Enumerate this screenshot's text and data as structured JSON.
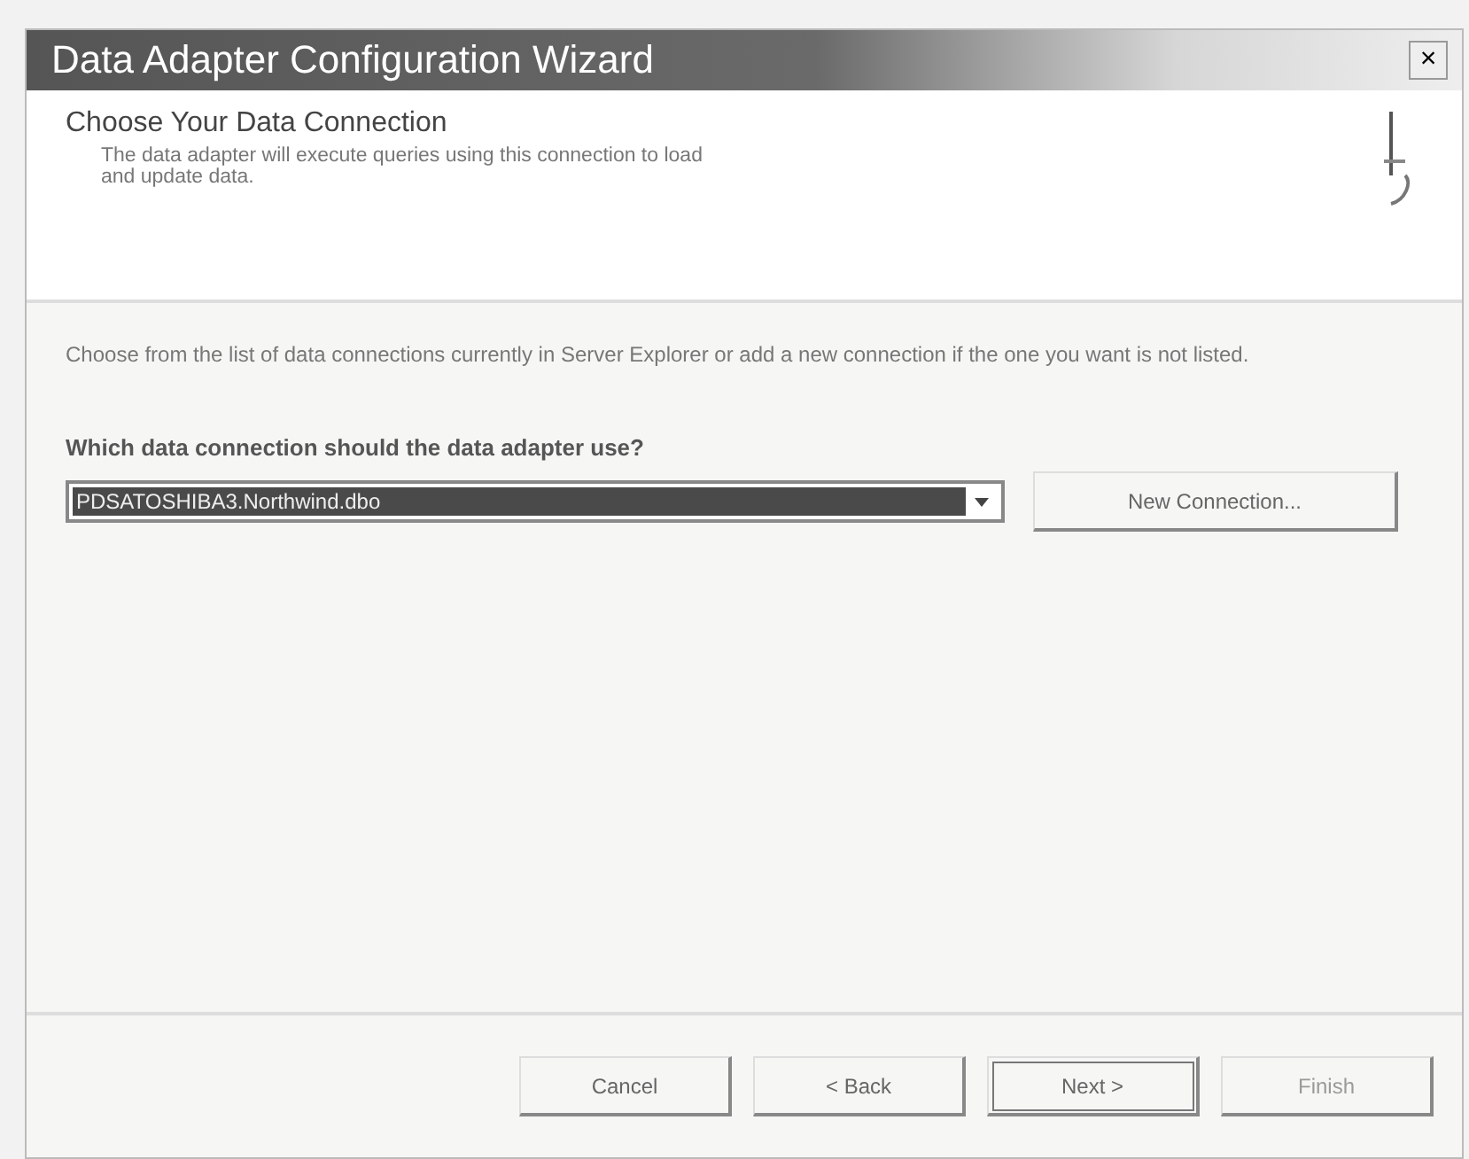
{
  "window": {
    "title": "Data Adapter Configuration Wizard",
    "close": "×"
  },
  "header": {
    "title": "Choose Your Data Connection",
    "subtitle": "The data adapter will execute queries using this connection to load and update data."
  },
  "intro": "Choose from the list of data connections currently in Server Explorer or add a new connection if the one you want is not listed.",
  "question": "Which data connection should the data adapter use?",
  "connection": {
    "value": "PDSATOSHIBA3.Northwind.dbo",
    "selected": true
  },
  "new_connection_button": "New Connection...",
  "buttons": [
    {
      "label": "Cancel",
      "disabled": false,
      "default": false
    },
    {
      "label": "< Back",
      "disabled": false,
      "default": false
    },
    {
      "label": "Next >",
      "disabled": false,
      "default": true
    },
    {
      "label": "Finish",
      "disabled": true,
      "default": false
    }
  ]
}
